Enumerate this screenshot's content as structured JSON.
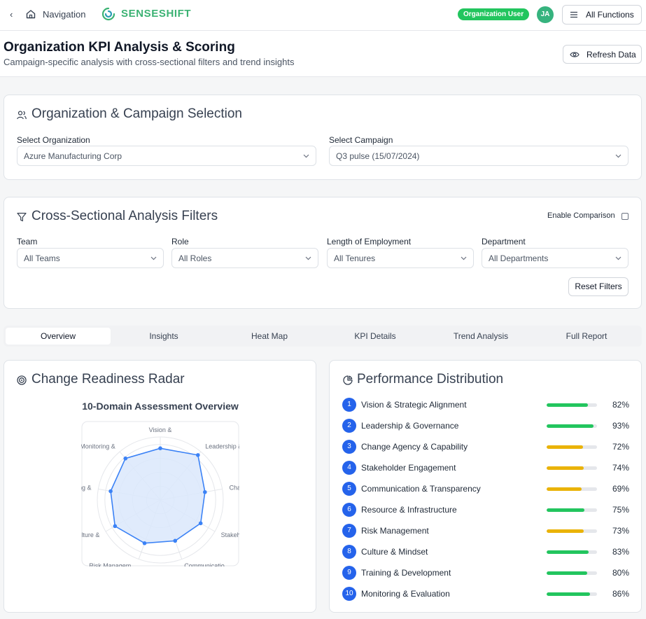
{
  "topbar": {
    "nav_label": "Navigation",
    "brand": "SENSESHIFT",
    "user_badge": "Organization User",
    "avatar_initials": "JA",
    "all_functions": "All Functions"
  },
  "header": {
    "title": "Organization KPI Analysis & Scoring",
    "subtitle": "Campaign-specific analysis with cross-sectional filters and trend insights",
    "refresh_label": "Refresh Data"
  },
  "selection": {
    "title": "Organization & Campaign Selection",
    "org_label": "Select Organization",
    "org_value": "Azure Manufacturing Corp",
    "campaign_label": "Select Campaign",
    "campaign_value": "Q3 pulse (15/07/2024)"
  },
  "filters": {
    "title": "Cross-Sectional Analysis Filters",
    "enable_comparison": "Enable Comparison",
    "comparison_checked": false,
    "team": {
      "label": "Team",
      "value": "All Teams"
    },
    "role": {
      "label": "Role",
      "value": "All Roles"
    },
    "tenure": {
      "label": "Length of Employment",
      "value": "All Tenures"
    },
    "department": {
      "label": "Department",
      "value": "All Departments"
    },
    "reset_label": "Reset Filters"
  },
  "tabs": [
    {
      "label": "Overview",
      "active": true
    },
    {
      "label": "Insights",
      "active": false
    },
    {
      "label": "Heat Map",
      "active": false
    },
    {
      "label": "KPI Details",
      "active": false
    },
    {
      "label": "Trend Analysis",
      "active": false
    },
    {
      "label": "Full Report",
      "active": false
    }
  ],
  "radar": {
    "title": "Change Readiness Radar",
    "subtitle": "10-Domain Assessment Overview"
  },
  "distribution": {
    "title": "Performance Distribution"
  },
  "colors": {
    "brand": "#3bb273",
    "badge": "#22c55e",
    "bar_green": "#22c55e",
    "bar_amber": "#eab308",
    "number_blue": "#2563eb",
    "radar_line": "#3b82f6",
    "radar_fill": "#dbe7fb"
  },
  "chart_data": [
    {
      "type": "radar",
      "title": "10-Domain Assessment Overview",
      "categories": [
        "Vision &",
        "Leadership &",
        "Change Ag",
        "Stakehold",
        "Communicatio...",
        "Risk Managem...",
        "ulture &",
        "aining &",
        "Monitoring &"
      ],
      "values": [
        82,
        93,
        72,
        74,
        69,
        73,
        83,
        80,
        86
      ],
      "rlim": [
        0,
        100
      ]
    },
    {
      "type": "bar",
      "title": "Performance Distribution",
      "categories": [
        "Vision & Strategic Alignment",
        "Leadership & Governance",
        "Change Agency & Capability",
        "Stakeholder Engagement",
        "Communication & Transparency",
        "Resource & Infrastructure",
        "Risk Management",
        "Culture & Mindset",
        "Training & Development",
        "Monitoring & Evaluation"
      ],
      "numbers": [
        "1",
        "2",
        "3",
        "4",
        "5",
        "6",
        "7",
        "8",
        "9",
        "10"
      ],
      "values": [
        82,
        93,
        72,
        74,
        69,
        75,
        73,
        83,
        80,
        86
      ],
      "labels": [
        "82%",
        "93%",
        "72%",
        "74%",
        "69%",
        "75%",
        "73%",
        "83%",
        "80%",
        "86%"
      ],
      "status": [
        "good",
        "good",
        "warn",
        "warn",
        "warn",
        "good",
        "warn",
        "good",
        "good",
        "good"
      ],
      "ylim": [
        0,
        100
      ]
    }
  ]
}
